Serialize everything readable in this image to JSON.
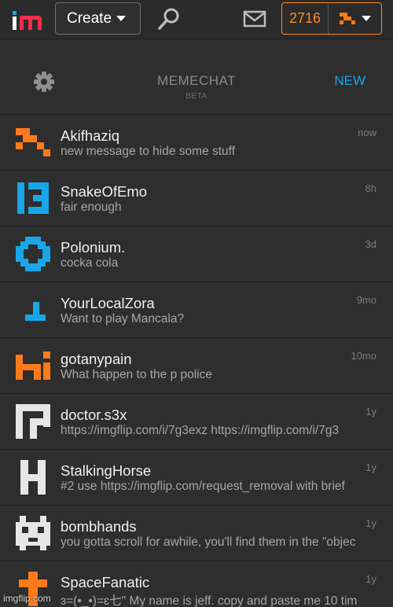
{
  "topbar": {
    "create_label": "Create",
    "points": "2716",
    "icons": [
      "imgflip-logo",
      "search-icon",
      "mail-icon",
      "user-avatar",
      "chevron-down-icon"
    ]
  },
  "chat": {
    "title": "MEMECHAT",
    "beta": "BETA",
    "new_label": "NEW",
    "settings_icon": "gear-icon"
  },
  "conversations": [
    {
      "name": "Akifhaziq",
      "message": "new message to hide some stuff",
      "time": "now",
      "avatar_color": "#ff7a1a"
    },
    {
      "name": "SnakeOfEmo",
      "message": "fair enough",
      "time": "8h",
      "avatar_color": "#19a6e8"
    },
    {
      "name": "Polonium.",
      "message": "cocka cola",
      "time": "3d",
      "avatar_color": "#19a6e8"
    },
    {
      "name": "YourLocalZora",
      "message": "Want to play Mancala?",
      "time": "9mo",
      "avatar_color": "#19a6e8"
    },
    {
      "name": "gotanypain",
      "message": "What happen to the p police",
      "time": "10mo",
      "avatar_color": "#ff7a1a"
    },
    {
      "name": "doctor.s3x",
      "message": "https://imgflip.com/i/7g3exz https://imgflip.com/i/7g3",
      "time": "1y",
      "avatar_color": "#e6e6e6"
    },
    {
      "name": "StalkingHorse",
      "message": "#2 use https://imgflip.com/request_removal with brief",
      "time": "1y",
      "avatar_color": "#e6e6e6"
    },
    {
      "name": "bombhands",
      "message": "you gotta scroll for awhile, you'll find them in the \"objec",
      "time": "1y",
      "avatar_color": "#e6e6e6"
    },
    {
      "name": "SpaceFanatic",
      "message": "ɜ=(•_•)=ɛ七\" My name is jeff. copy and paste me 10 tim",
      "time": "1y",
      "avatar_color": "#ff7a1a"
    }
  ],
  "watermark": "imgflip.com"
}
